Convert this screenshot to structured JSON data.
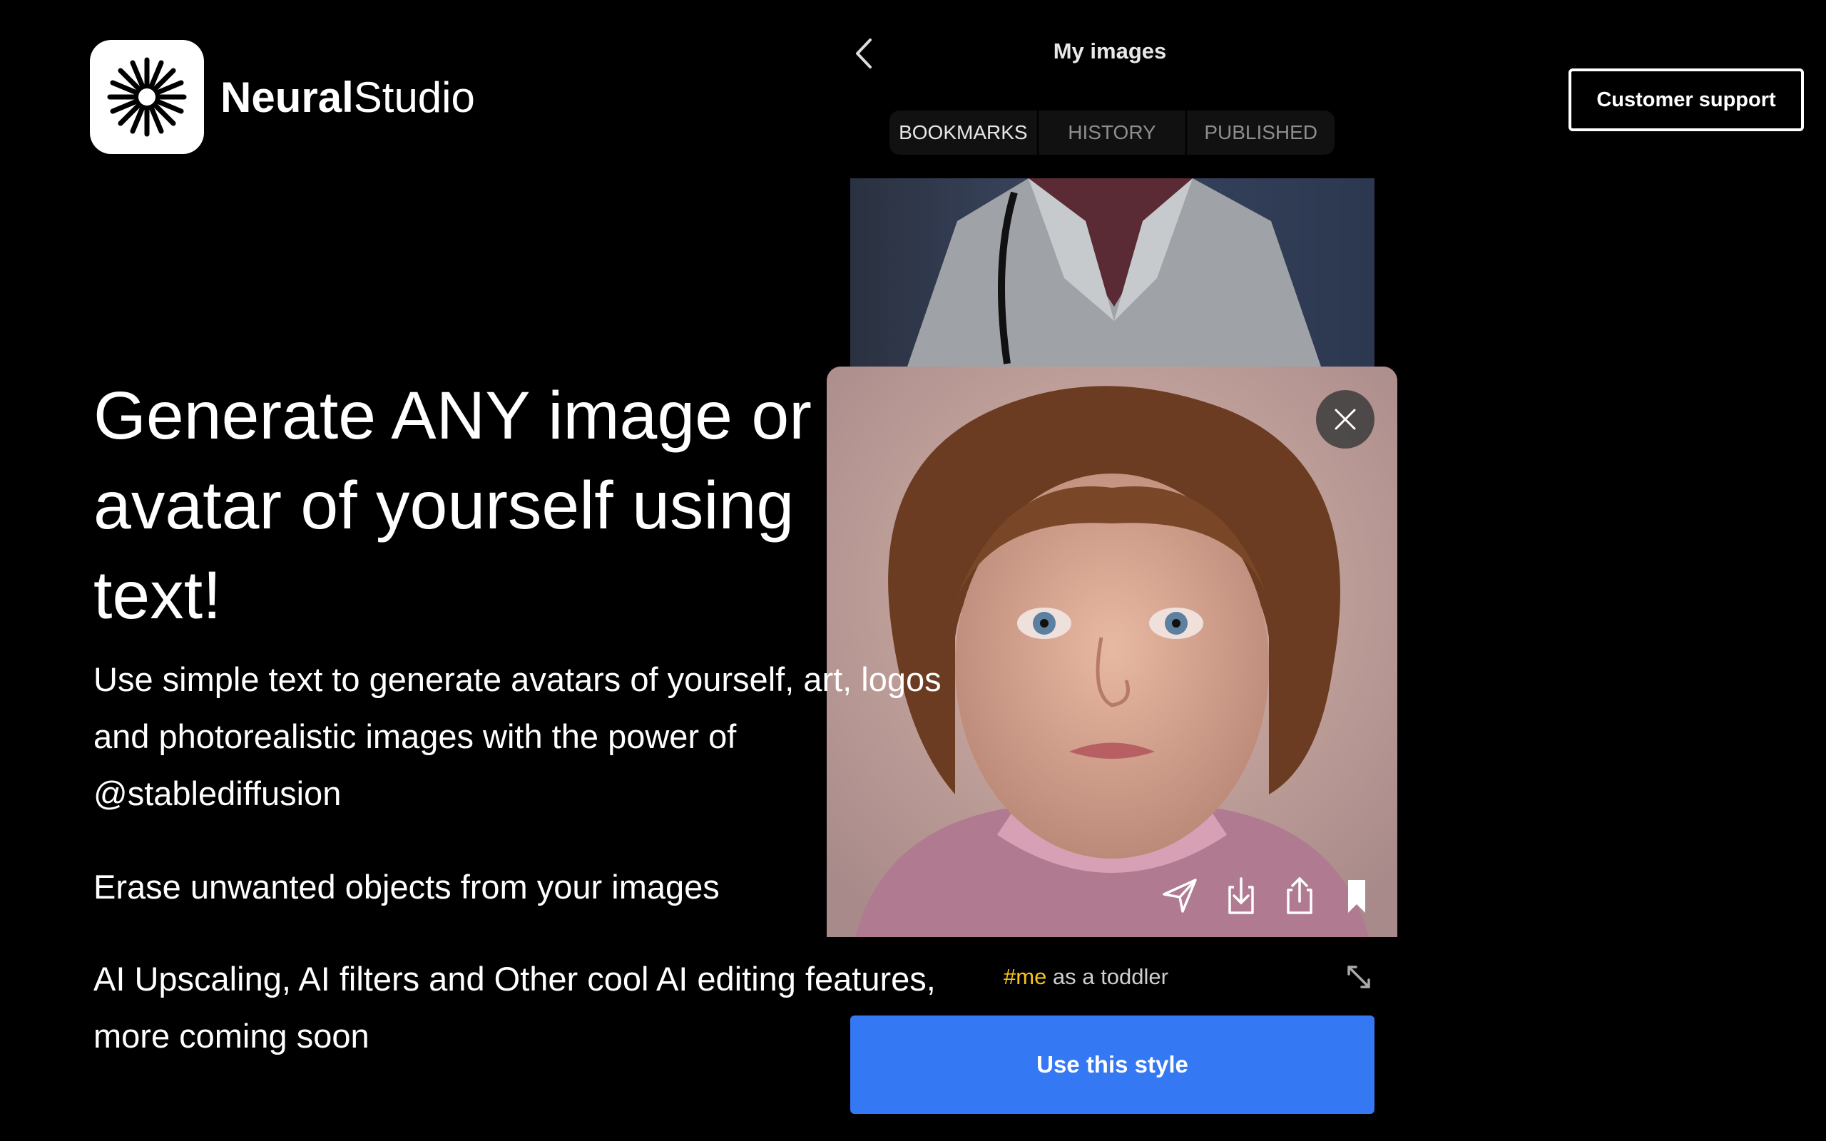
{
  "brand": {
    "name_bold": "Neural",
    "name_light": "Studio",
    "logo_icon": "starburst-icon"
  },
  "header": {
    "title": "My images",
    "back_icon": "chevron-left-icon",
    "support_label": "Customer support"
  },
  "tabs": [
    {
      "label": "BOOKMARKS",
      "active": true
    },
    {
      "label": "HISTORY",
      "active": false
    },
    {
      "label": "PUBLISHED",
      "active": false
    }
  ],
  "hero": {
    "headline": "Generate ANY image or avatar of yourself using text!",
    "lines": [
      "Use simple text to generate avatars of yourself, art, logos",
      "and photorealistic images with the power of",
      "@stablediffusion"
    ],
    "erase": "Erase unwanted objects from your images",
    "upscale": [
      "AI Upscaling, AI filters and Other cool AI editing features,",
      "more coming soon"
    ]
  },
  "preview": {
    "caption_tag": "#me",
    "caption_text": " as a toddler",
    "actions": [
      "send-icon",
      "download-icon",
      "share-icon",
      "bookmark-icon"
    ],
    "use_label": "Use this style",
    "colors": {
      "accent": "#3578f3",
      "tag": "#f5c518"
    }
  }
}
